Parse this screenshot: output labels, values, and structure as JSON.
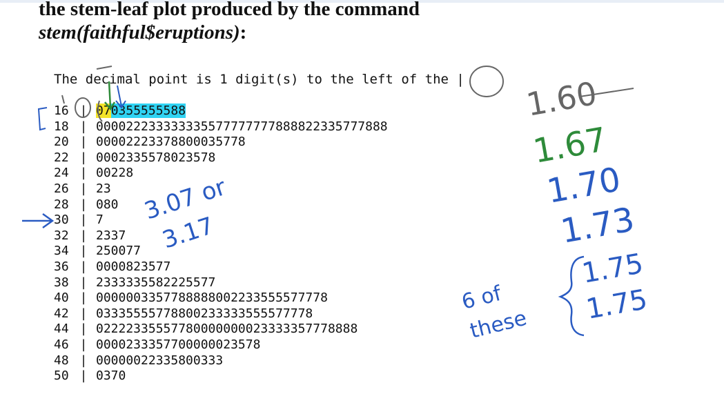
{
  "title": {
    "line1": "the stem-leaf plot produced by the command",
    "line2": "stem(faithful$eruptions)",
    "colon": ":"
  },
  "intro": "The decimal point is 1 digit(s) to the left of the |",
  "rows": [
    {
      "stem": "16",
      "leaves_a": "07",
      "leaves_b": "0355555588"
    },
    {
      "stem": "18",
      "leaves_a": "000022233333335577777777888822335777888",
      "leaves_b": ""
    },
    {
      "stem": "20",
      "leaves_a": "00002223378800035778",
      "leaves_b": ""
    },
    {
      "stem": "22",
      "leaves_a": "0002335578023578",
      "leaves_b": ""
    },
    {
      "stem": "24",
      "leaves_a": "00228",
      "leaves_b": ""
    },
    {
      "stem": "26",
      "leaves_a": "23",
      "leaves_b": ""
    },
    {
      "stem": "28",
      "leaves_a": "080",
      "leaves_b": ""
    },
    {
      "stem": "30",
      "leaves_a": "7",
      "leaves_b": ""
    },
    {
      "stem": "32",
      "leaves_a": "2337",
      "leaves_b": ""
    },
    {
      "stem": "34",
      "leaves_a": "250077",
      "leaves_b": ""
    },
    {
      "stem": "36",
      "leaves_a": "0000823577",
      "leaves_b": ""
    },
    {
      "stem": "38",
      "leaves_a": "2333335582225577",
      "leaves_b": ""
    },
    {
      "stem": "40",
      "leaves_a": "0000003357788888002233555577778",
      "leaves_b": ""
    },
    {
      "stem": "42",
      "leaves_a": "03335555778800233333555577778",
      "leaves_b": ""
    },
    {
      "stem": "44",
      "leaves_a": "02222335557780000000023333357778888",
      "leaves_b": ""
    },
    {
      "stem": "46",
      "leaves_a": "0000233357700000023578",
      "leaves_b": ""
    },
    {
      "stem": "48",
      "leaves_a": "00000022335800333",
      "leaves_b": ""
    },
    {
      "stem": "50",
      "leaves_a": "0370",
      "leaves_b": ""
    }
  ],
  "bar_char": "|",
  "annotations": {
    "v1": "1.60",
    "v2": "1.67",
    "v3": "1.70",
    "v4": "1.73",
    "v5": "1.75",
    "v6": "1.75",
    "mid1": "3.07 or",
    "mid2": "3.17",
    "count1": "6 of",
    "count2": "these",
    "colors": {
      "blue": "#2a5bc2",
      "green": "#2e8b3a",
      "gray": "#666666"
    }
  }
}
